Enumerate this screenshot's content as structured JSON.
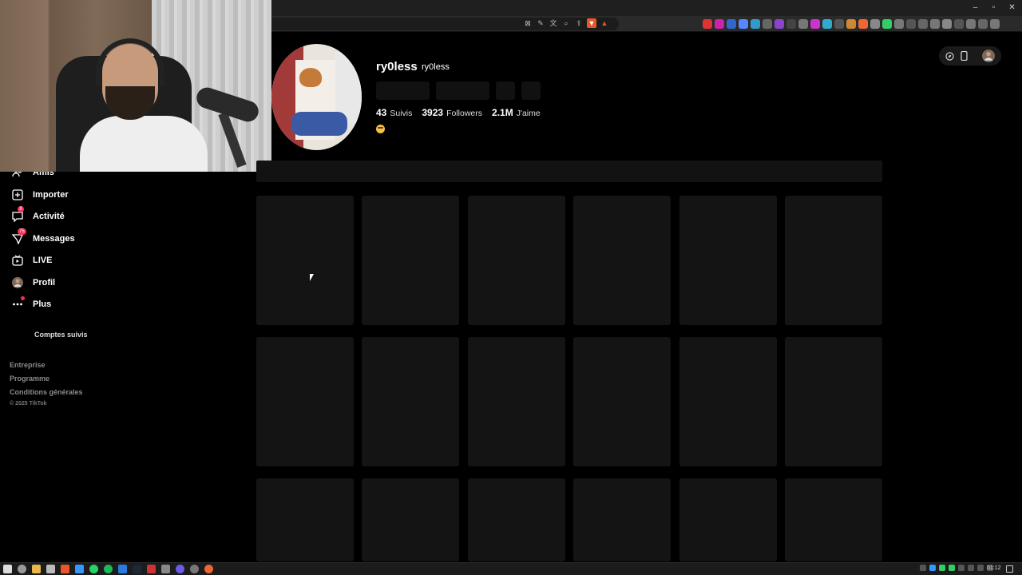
{
  "window_controls": [
    "–",
    "▫",
    "✕"
  ],
  "sidebar": {
    "items": [
      {
        "label": "Amis",
        "icon": "friends-icon"
      },
      {
        "label": "Importer",
        "icon": "upload-icon"
      },
      {
        "label": "Activité",
        "icon": "activity-icon",
        "badge": "8"
      },
      {
        "label": "Messages",
        "icon": "messages-icon",
        "badge": "75"
      },
      {
        "label": "LIVE",
        "icon": "live-icon"
      },
      {
        "label": "Profil",
        "icon": "profile-avatar-icon"
      },
      {
        "label": "Plus",
        "icon": "more-icon"
      }
    ],
    "following_section": "Comptes suivis",
    "footer": {
      "company": "Entreprise",
      "program": "Programme",
      "terms": "Conditions générales",
      "copyright": "© 2025 TikTok"
    }
  },
  "profile": {
    "username": "ry0less",
    "nickname": "ry0less",
    "stats": {
      "following_count": "43",
      "following_label": "Suivis",
      "followers_count": "3923",
      "followers_label": "Followers",
      "likes_count": "2.1M",
      "likes_label": "J'aime"
    },
    "bio_icon": "smiling-emoji-icon"
  },
  "colors": {
    "background": "#000000",
    "accent": "#fe2c55",
    "skeleton": "#141414"
  },
  "taskbar": {
    "clock": "01:12"
  }
}
